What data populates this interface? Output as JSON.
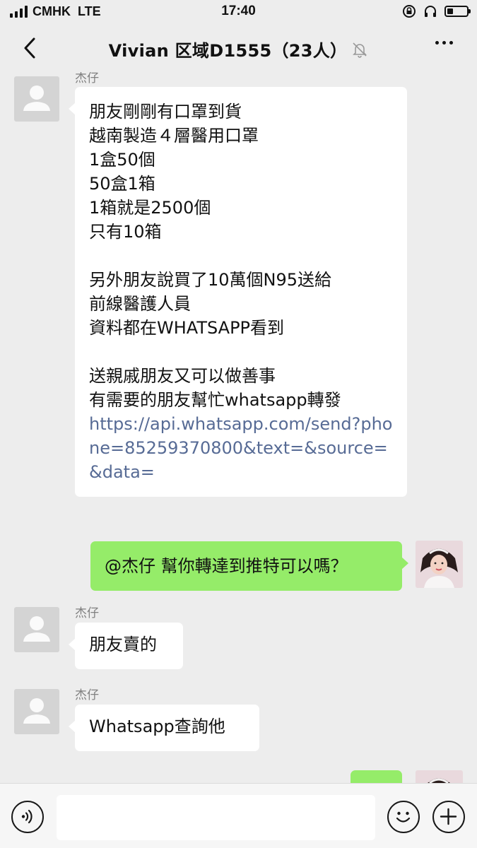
{
  "status_bar": {
    "carrier": "CMHK",
    "network": "LTE",
    "time": "17:40",
    "battery_level": 0.3,
    "icons": [
      "lock-rotation-icon",
      "headphones-icon",
      "battery-icon"
    ]
  },
  "nav": {
    "title": "Vivian 区域D1555（23人）",
    "icons": [
      "back-arrow-icon",
      "mute-bell-icon",
      "more-icon"
    ]
  },
  "messages": [
    {
      "side": "left",
      "sender": "杰仔",
      "text": "朋友剛剛有口罩到貨\n越南製造４層醫用口罩\n1盒50個\n50盒1箱\n1箱就是2500個\n只有10箱\n\n另外朋友說買了10萬個N95送給\n前線醫護人員\n資料都在WHATSAPP看到\n\n送親戚朋友又可以做善事\n有需要的朋友幫忙whatsapp轉發\n",
      "link": "https://api.whatsapp.com/send?phone=85259370800&text=&source=&data="
    },
    {
      "side": "right",
      "text": "@杰仔 幫你轉達到推特可以嗎？"
    },
    {
      "side": "left",
      "sender": "杰仔",
      "text": "朋友賣的"
    },
    {
      "side": "left",
      "sender": "杰仔",
      "text": "Whatsapp查詢他"
    },
    {
      "side": "right",
      "text": ""
    }
  ],
  "input_bar": {
    "value": "",
    "icons": [
      "voice-icon",
      "emoji-icon",
      "plus-icon"
    ]
  },
  "colors": {
    "background": "#ededed",
    "sent_bubble": "#95ec69",
    "received_bubble": "#ffffff",
    "link": "#576b95",
    "sender_name": "#7f7f7f"
  }
}
